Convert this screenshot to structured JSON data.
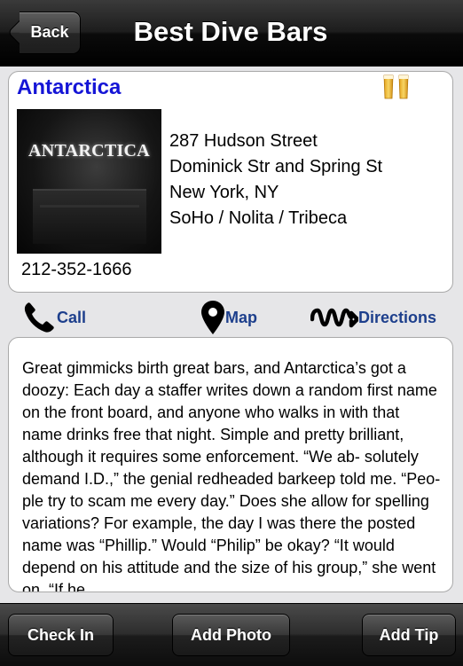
{
  "navbar": {
    "back_label": "Back",
    "title": "Best Dive Bars"
  },
  "venue": {
    "name": "Antarctica",
    "photo_sign_text": "ANTARCTICA",
    "address_lines": [
      "287 Hudson Street",
      "Dominick Str and Spring St",
      "New York, NY",
      "SoHo / Nolita / Tribeca"
    ],
    "phone": "212-352-1666",
    "icons": {
      "rating": "beer-glasses-icon",
      "photo": "venue-photo"
    }
  },
  "actions": {
    "call_label": "Call",
    "map_label": "Map",
    "directions_label": "Directions",
    "icons": [
      "phone-icon",
      "map-pin-icon",
      "directions-icon"
    ]
  },
  "description": {
    "text": "Great gimmicks birth great bars, and Antarctica’s got a doozy: Each day a staffer writes down a random first name on the front board, and anyone who walks in with that name drinks free that night. Simple and pretty brilliant, although it requires some enforcement. “We ab- solutely demand I.D.,” the genial redheaded barkeep told me. “Peo- ple try to scam me every day.” Does she allow for spelling variations? For example, the day I was there the posted name was “Phillip.” Would “Philip” be okay? “It would depend on his attitude and the size of his group,” she went on. “If he"
  },
  "toolbar": {
    "check_in_label": "Check In",
    "add_photo_label": "Add Photo",
    "add_tip_label": "Add Tip"
  },
  "colors": {
    "venue_name": "#1515d6",
    "action_link": "#1d3f8c",
    "bar_dark": "#000000",
    "background": "#e6e6e8"
  }
}
